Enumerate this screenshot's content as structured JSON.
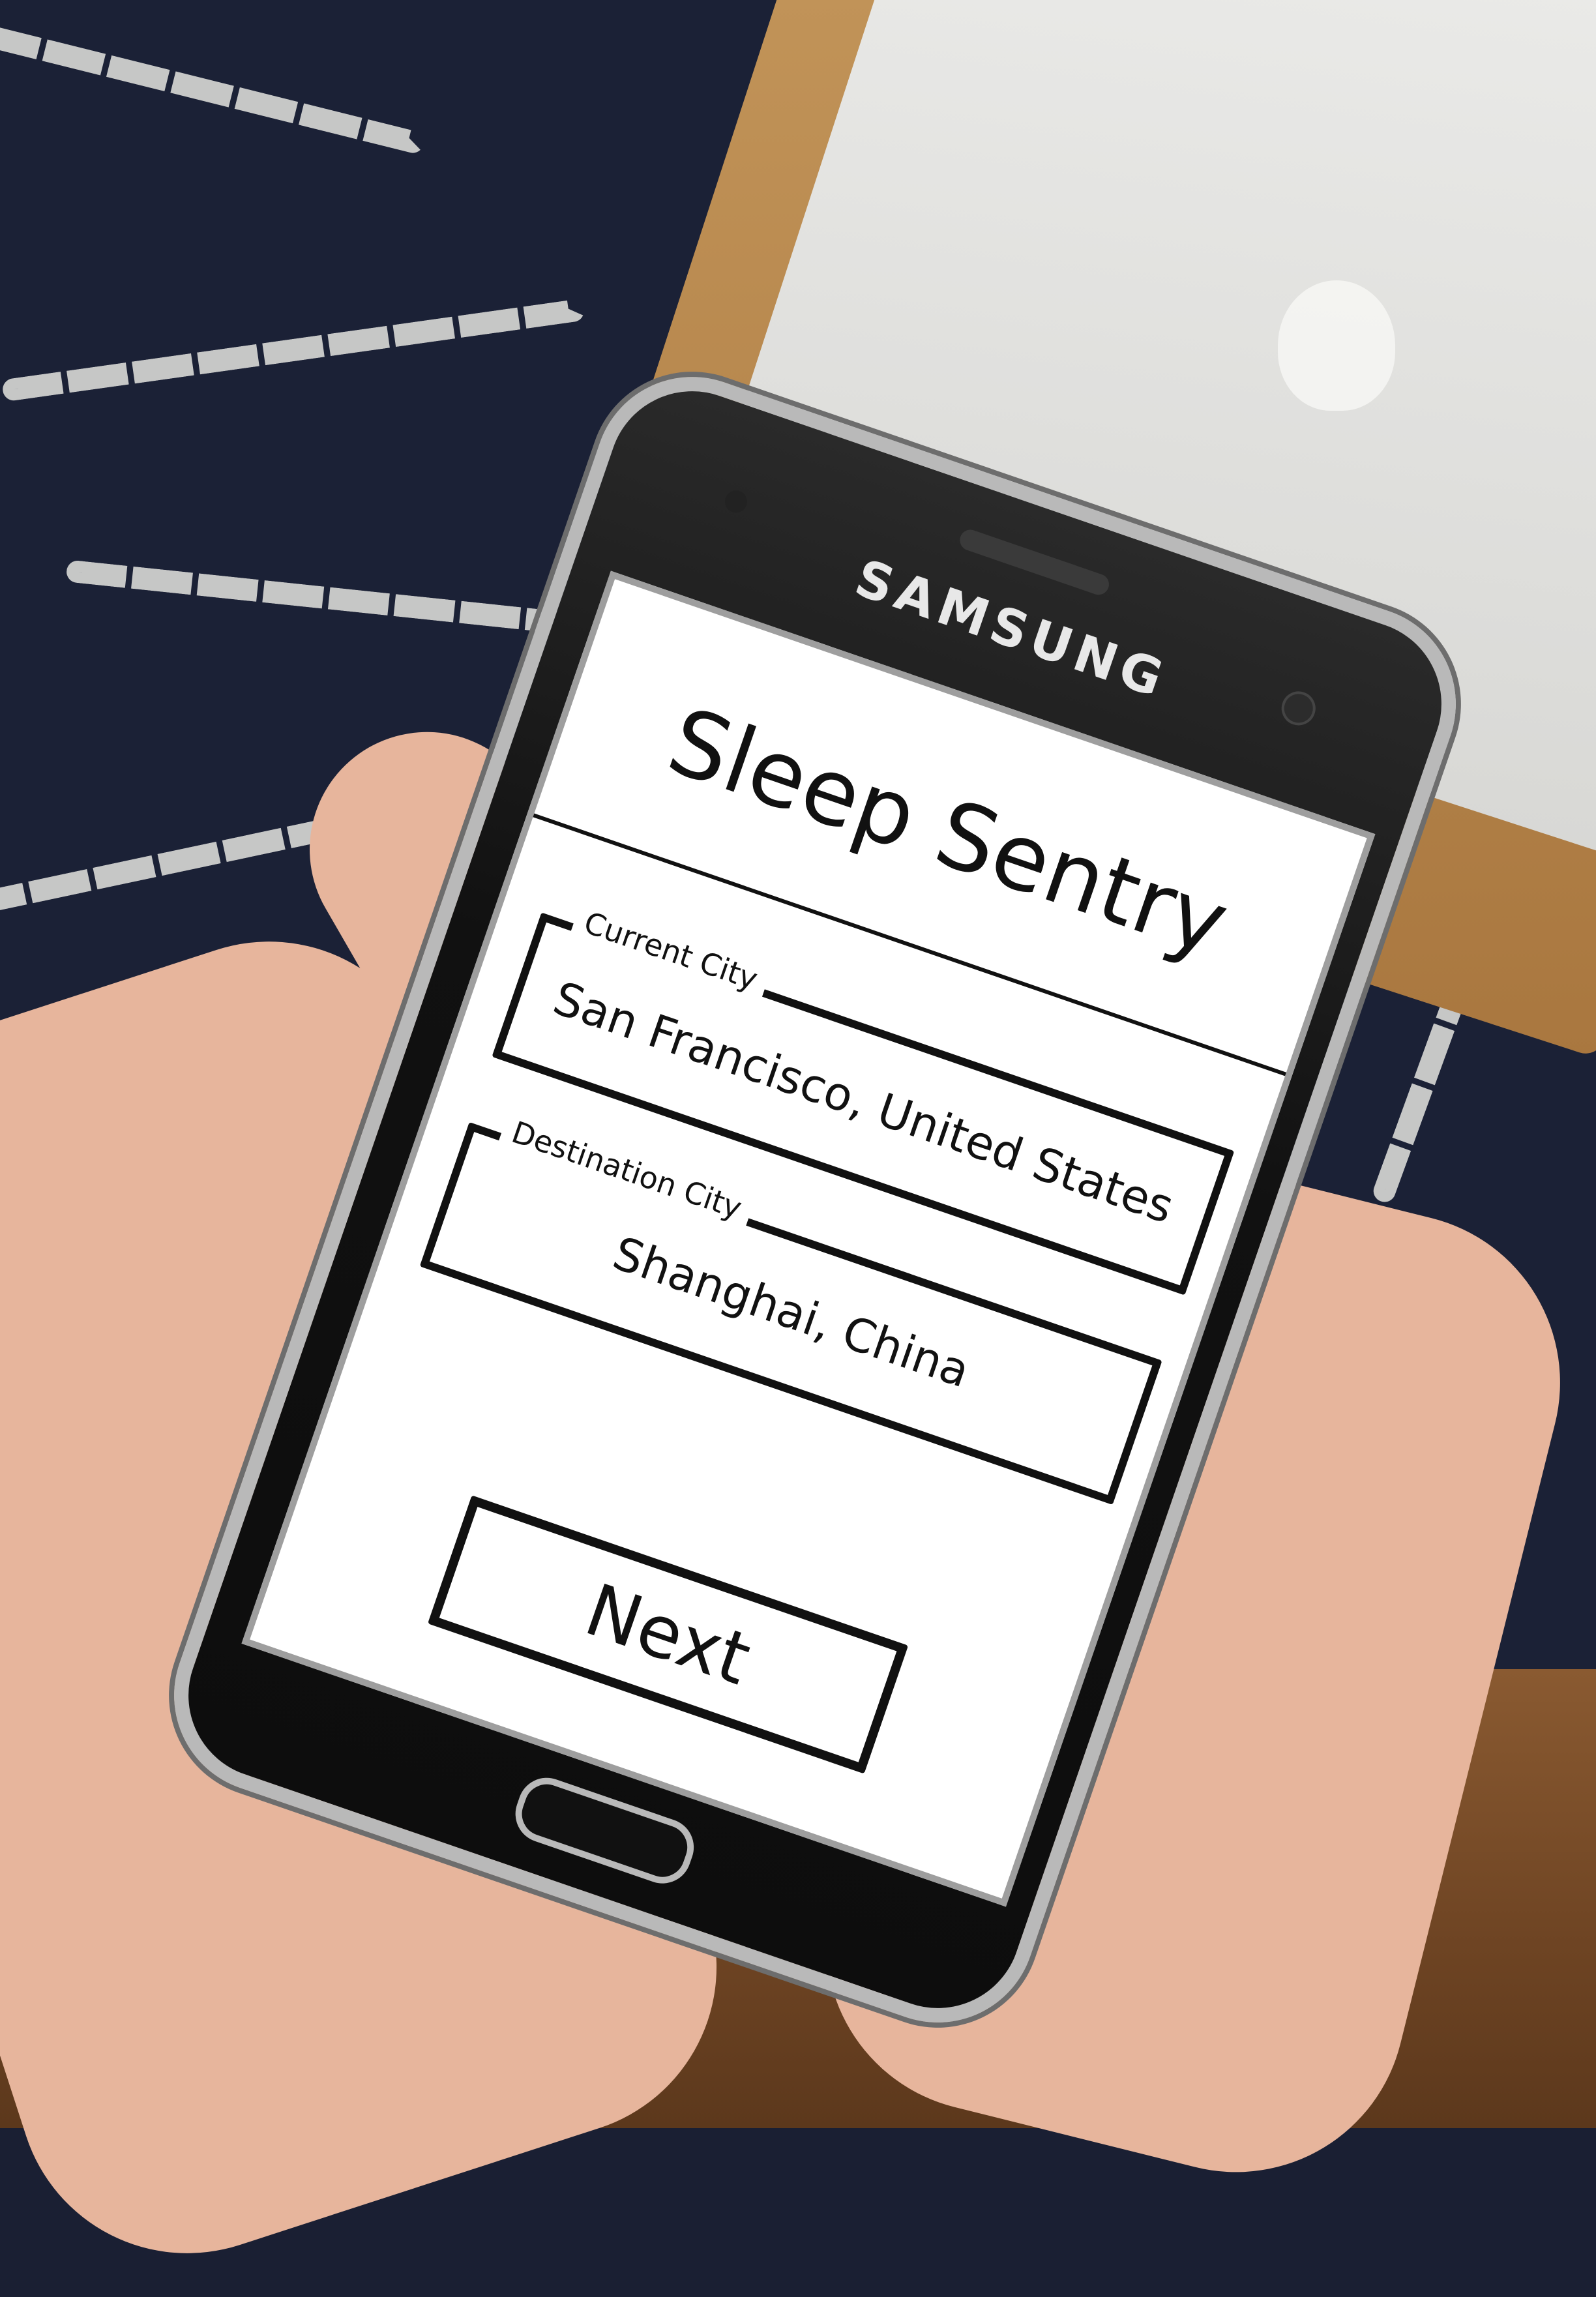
{
  "device": {
    "brand": "SAMSUNG"
  },
  "app": {
    "title": "Sleep Sentry",
    "current_city": {
      "label": "Current City",
      "value": "San Francisco, United States"
    },
    "destination_city": {
      "label": "Destination City",
      "value": "Shanghai, China"
    },
    "next_label": "Next"
  },
  "colors": {
    "screen_bg": "#ffffff",
    "ink": "#111111",
    "phone_body": "#111111",
    "phone_bezel": "#b9b9b9"
  }
}
